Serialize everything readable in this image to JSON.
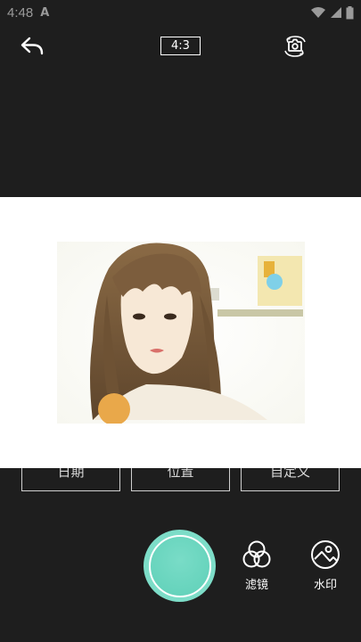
{
  "status_bar": {
    "time": "4:48",
    "indicator": "A"
  },
  "top_bar": {
    "aspect_ratio": "4:3",
    "back_icon": "back-arrow-icon",
    "switch_icon": "switch-camera-icon"
  },
  "watermark_tabs": [
    {
      "label": "日期"
    },
    {
      "label": "位置"
    },
    {
      "label": "自定义"
    }
  ],
  "bottom_tools": {
    "filter_label": "滤镜",
    "watermark_label": "水印"
  },
  "colors": {
    "shutter": "#6fd8c2",
    "background": "#1e1e1e"
  }
}
